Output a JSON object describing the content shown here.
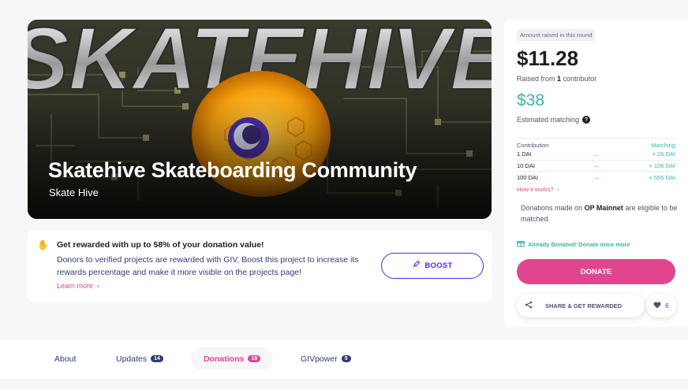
{
  "hero": {
    "title": "Skatehive Skateboarding Community",
    "subtitle": "Skate Hive",
    "banner_word": "SKATEHIVE"
  },
  "reward": {
    "title": "Get rewarded with up to 58% of your donation value!",
    "body": "Donors to verified projects are rewarded with GIV. Boost this project to increase its rewards percentage and make it more visible on the projects page!",
    "learn_more": "Learn more",
    "boost_label": "BOOST",
    "icon": "hand-icon"
  },
  "panel": {
    "round_badge": "Amount raised in this round",
    "amount": "$11.28",
    "raised_prefix": "Raised from",
    "raised_count": "1",
    "raised_suffix": "contributor",
    "matching_amount": "$38",
    "estimated_label": "Estimated matching",
    "table": {
      "col_contribution": "Contribution",
      "col_matching": "Matching",
      "rows": [
        {
          "contribution": "1 DAI",
          "matching": "+ 26  DAI"
        },
        {
          "contribution": "10 DAI",
          "matching": "+ 106  DAI"
        },
        {
          "contribution": "100 DAI",
          "matching": "+ 555  DAI"
        }
      ],
      "how_it_works": "How it works?"
    },
    "op_note_prefix": "Donations made on",
    "op_note_network": "OP Mainnet",
    "op_note_suffix": "are eligible to be matched.",
    "already_donated": "Already Donated! Donate once more",
    "donate_label": "DONATE",
    "share_label": "SHARE & GET REWARDED",
    "likes": "6"
  },
  "tabs": [
    {
      "label": "About",
      "count": ""
    },
    {
      "label": "Updates",
      "count": "14"
    },
    {
      "label": "Donations",
      "count": "18"
    },
    {
      "label": "GIVpower",
      "count": "5"
    }
  ],
  "colors": {
    "accent_pink": "#e1458d",
    "accent_purple": "#5326ec",
    "teal": "#37b4a9",
    "navy": "#303b72"
  }
}
